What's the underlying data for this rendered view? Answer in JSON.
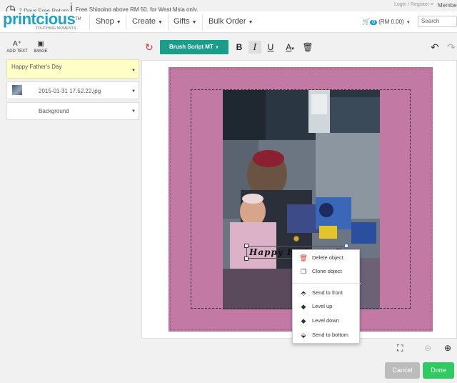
{
  "topbar": {
    "return_text": "7 Days Free Return",
    "shipping_text": "Free Shipping above RM 50, for West Msia only.",
    "login_text": "Login / Register >",
    "member_text": "Membe"
  },
  "header": {
    "logo_text": "printcious",
    "logo_tm": "TM",
    "logo_tagline": "TOUCHING MOMENTS",
    "nav": [
      {
        "label": "Shop"
      },
      {
        "label": "Create"
      },
      {
        "label": "Gifts"
      },
      {
        "label": "Bulk Order"
      }
    ],
    "cart_count": "0",
    "cart_total": "(RM 0.00)",
    "search_placeholder": "Search"
  },
  "tools": {
    "add_text_label": "ADD TEXT",
    "image_label": "IMAGE"
  },
  "layers": [
    {
      "label": "Happy Father's Day",
      "active": true
    },
    {
      "label": "2015-01-31 17.52.22.jpg",
      "active": false
    },
    {
      "label": "Background",
      "active": false
    }
  ],
  "toolbar": {
    "font_label": "Brush Script MT"
  },
  "canvas": {
    "text_content": "Happy Father's Day",
    "product_color": "#c27aa4"
  },
  "context_menu": {
    "delete": "Delete object",
    "clone": "Clone object",
    "send_front": "Send to front",
    "level_up": "Level up",
    "level_down": "Level down",
    "send_bottom": "Send to bottom"
  },
  "actions": {
    "cancel": "Cancel",
    "done": "Done"
  },
  "colors": {
    "brand": "#1ea0cc",
    "font_button": "#1a9e8a",
    "done": "#2fcb62",
    "cancel": "#bcbcbc",
    "active_layer": "#ffffc6"
  }
}
